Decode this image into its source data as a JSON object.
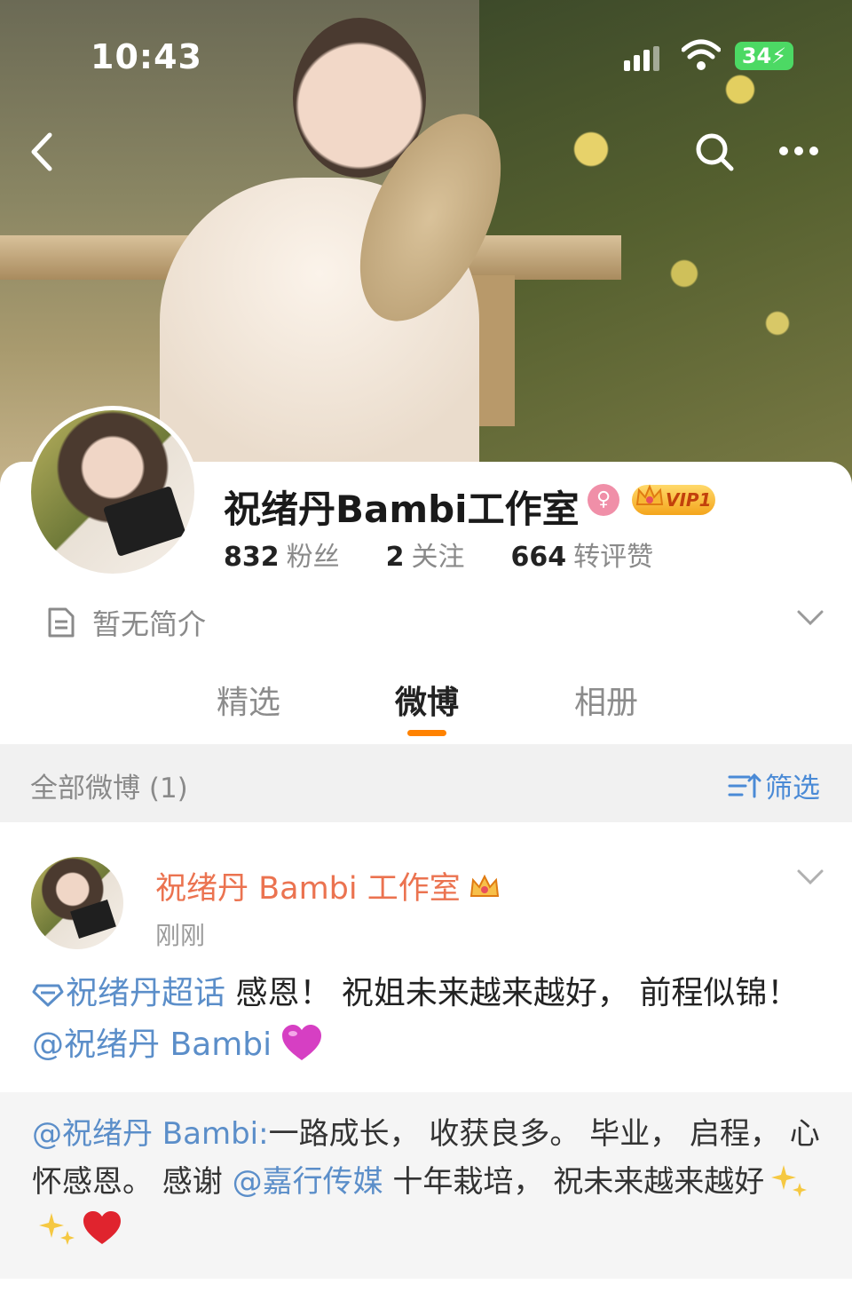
{
  "status_bar": {
    "time": "10:43",
    "battery": "34"
  },
  "profile": {
    "name": "祝绪丹Bambi工作室",
    "vip_label": "VIP1",
    "gender_symbol": "♀",
    "stats": [
      {
        "value": "832",
        "label": "粉丝"
      },
      {
        "value": "2",
        "label": "关注"
      },
      {
        "value": "664",
        "label": "转评赞"
      }
    ],
    "bio": "暂无简介"
  },
  "tabs": [
    {
      "label": "精选"
    },
    {
      "label": "微博"
    },
    {
      "label": "相册"
    }
  ],
  "filter_bar": {
    "title": "全部微博 (1)",
    "filter_label": "筛选"
  },
  "post": {
    "author": "祝绪丹 Bambi 工作室",
    "time": "刚刚",
    "topic": "祝绪丹超话",
    "text_main": " 感恩！ 祝姐未来越来越好， 前程似锦！ ",
    "mention": "@祝绪丹 Bambi",
    "repost": {
      "mention_author": "@祝绪丹 Bambi:",
      "text_a": "一路成长， 收获良多。 毕业， 启程， 心怀感恩。 感谢 ",
      "mention_company": "@嘉行传媒",
      "text_b": " 十年栽培， 祝未来越来越好"
    }
  },
  "colors": {
    "accent_orange": "#ff8200",
    "link_blue": "#5b8ec9",
    "author_orange": "#eb7350",
    "filter_blue": "#4a8ad6"
  }
}
